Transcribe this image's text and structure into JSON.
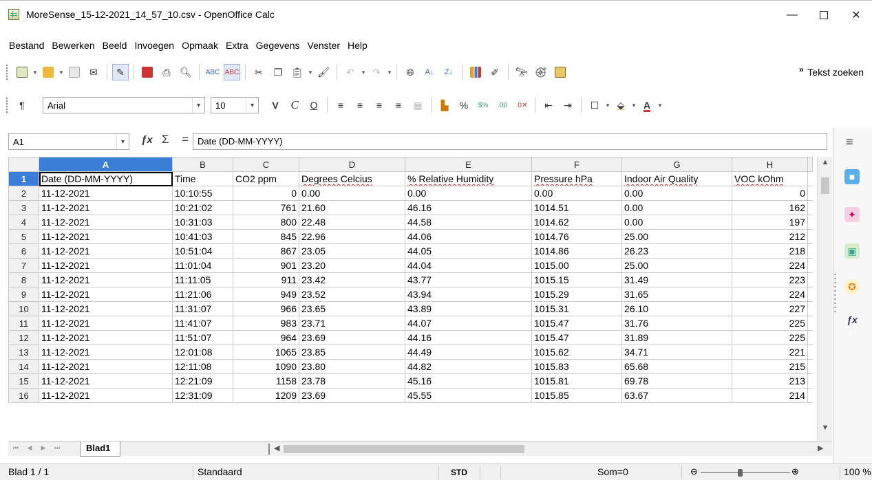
{
  "window": {
    "title": "MoreSense_15-12-2021_14_57_10.csv - OpenOffice Calc",
    "minimize": "—",
    "close": "✕"
  },
  "menu": [
    "Bestand",
    "Bewerken",
    "Beeld",
    "Invoegen",
    "Opmaak",
    "Extra",
    "Gegevens",
    "Venster",
    "Help"
  ],
  "toolbar": {
    "search_label": "Tekst zoeken",
    "font_name": "Arial",
    "font_size": "10",
    "bold_glyph": "V",
    "italic_glyph": "C",
    "underline_glyph": "O"
  },
  "formula_bar": {
    "cell_ref": "A1",
    "content": "Date (DD-MM-YYYY)"
  },
  "grid": {
    "col_letters": [
      "A",
      "B",
      "C",
      "D",
      "E",
      "F",
      "G",
      "H"
    ],
    "row_numbers": [
      "1",
      "2",
      "3",
      "4",
      "5",
      "6",
      "7",
      "8",
      "9",
      "10",
      "11",
      "12",
      "13",
      "14",
      "15",
      "16"
    ],
    "headers": [
      "Date (DD-MM-YYYY)",
      "Time",
      "CO2 ppm",
      "Degrees Celcius",
      "% Relative Humidity",
      "Pressure hPa",
      "Indoor Air Quality",
      "VOC kOhm"
    ],
    "rows": [
      [
        "11-12-2021",
        "10:10:55",
        "0",
        "0.00",
        "0.00",
        "0.00",
        "0.00",
        "0"
      ],
      [
        "11-12-2021",
        "10:21:02",
        "761",
        "21.60",
        "46.16",
        "1014.51",
        "0.00",
        "162"
      ],
      [
        "11-12-2021",
        "10:31:03",
        "800",
        "22.48",
        "44.58",
        "1014.62",
        "0.00",
        "197"
      ],
      [
        "11-12-2021",
        "10:41:03",
        "845",
        "22.96",
        "44.06",
        "1014.76",
        "25.00",
        "212"
      ],
      [
        "11-12-2021",
        "10:51:04",
        "867",
        "23.05",
        "44.05",
        "1014.86",
        "26.23",
        "218"
      ],
      [
        "11-12-2021",
        "11:01:04",
        "901",
        "23.20",
        "44.04",
        "1015.00",
        "25.00",
        "224"
      ],
      [
        "11-12-2021",
        "11:11:05",
        "911",
        "23.42",
        "43.77",
        "1015.15",
        "31.49",
        "223"
      ],
      [
        "11-12-2021",
        "11:21:06",
        "949",
        "23.52",
        "43.94",
        "1015.29",
        "31.65",
        "224"
      ],
      [
        "11-12-2021",
        "11:31:07",
        "966",
        "23.65",
        "43.89",
        "1015.31",
        "26.10",
        "227"
      ],
      [
        "11-12-2021",
        "11:41:07",
        "983",
        "23.71",
        "44.07",
        "1015.47",
        "31.76",
        "225"
      ],
      [
        "11-12-2021",
        "11:51:07",
        "964",
        "23.69",
        "44.16",
        "1015.47",
        "31.89",
        "225"
      ],
      [
        "11-12-2021",
        "12:01:08",
        "1065",
        "23.85",
        "44.49",
        "1015.62",
        "34.71",
        "221"
      ],
      [
        "11-12-2021",
        "12:11:08",
        "1090",
        "23.80",
        "44.82",
        "1015.83",
        "65.68",
        "215"
      ],
      [
        "11-12-2021",
        "12:21:09",
        "1158",
        "23.78",
        "45.16",
        "1015.81",
        "69.78",
        "213"
      ],
      [
        "11-12-2021",
        "12:31:09",
        "1209",
        "23.69",
        "45.55",
        "1015.85",
        "63.67",
        "214"
      ]
    ]
  },
  "sheet_tab": "Blad1",
  "status": {
    "page": "Blad 1 / 1",
    "style": "Standaard",
    "mode": "STD",
    "sum": "Som=0",
    "zoom": "100 %"
  },
  "colors": {
    "selection": "#3b7ed8",
    "header_bg": "#f0f0f0",
    "spell_error": "#d03030"
  }
}
